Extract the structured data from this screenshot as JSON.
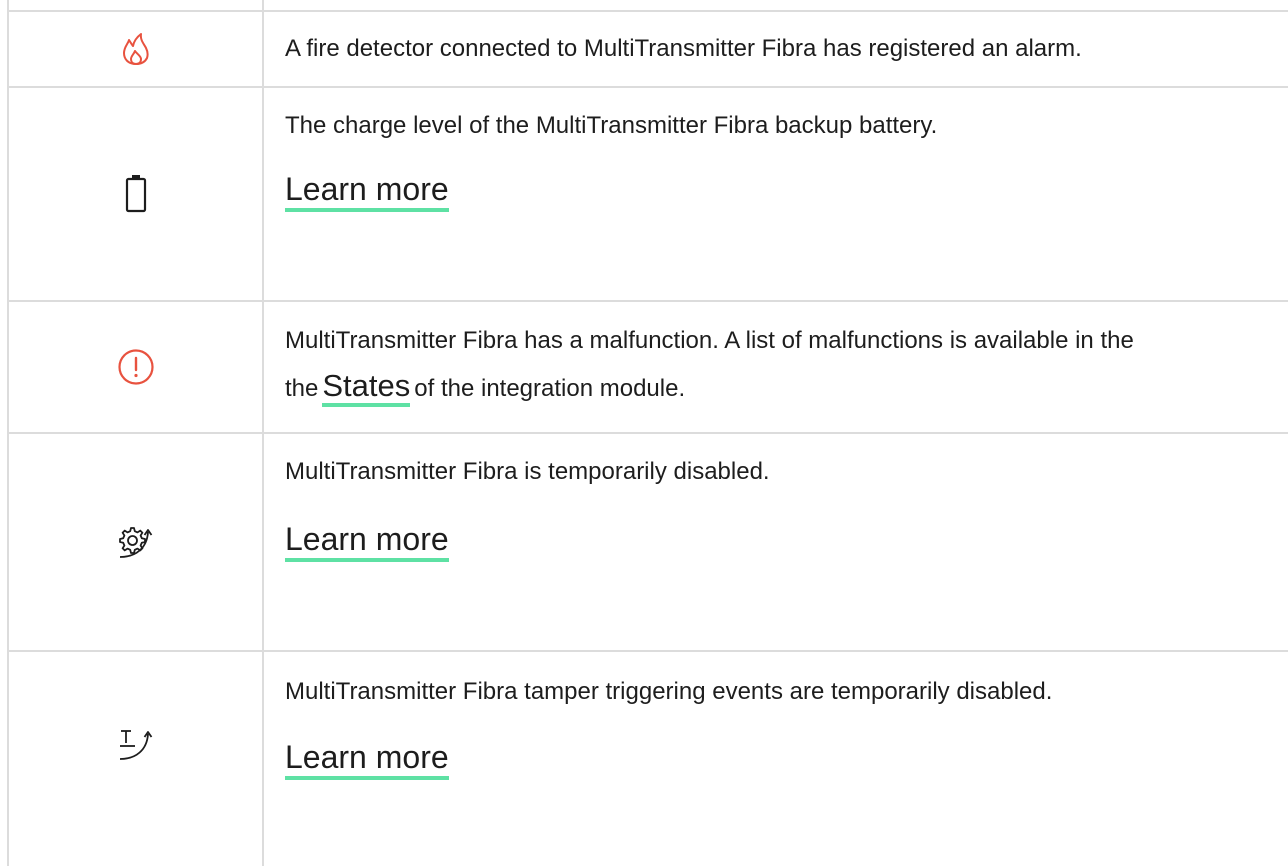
{
  "rows": [
    {
      "icon": "fire-icon",
      "description": "A fire detector connected to MultiTransmitter Fibra has registered an alarm."
    },
    {
      "icon": "battery-icon",
      "description": "The charge level of the MultiTransmitter Fibra backup battery.",
      "link_label": "Learn more"
    },
    {
      "icon": "malfunction-icon",
      "description_before": "MultiTransmitter Fibra has a malfunction. A list of malfunctions is available in the",
      "link_label": "States",
      "description_after": "of the integration module."
    },
    {
      "icon": "temporarily-disabled-icon",
      "description": "MultiTransmitter Fibra is temporarily disabled.",
      "link_label": "Learn more"
    },
    {
      "icon": "tamper-disabled-icon",
      "description": "MultiTransmitter Fibra tamper triggering events are temporarily disabled.",
      "link_label": "Learn more"
    }
  ],
  "colors": {
    "accent_underline": "#5ee1a4",
    "alert_red": "#e8523f",
    "border": "#dcdcdc"
  }
}
